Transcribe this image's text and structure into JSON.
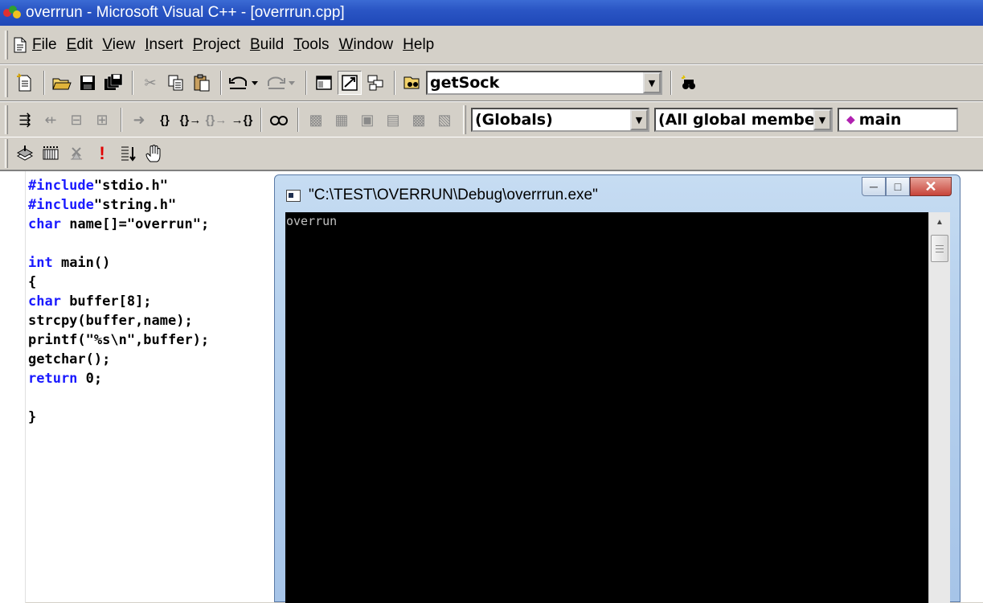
{
  "window": {
    "title": "overrrun - Microsoft Visual C++ - [overrrun.cpp]"
  },
  "menu": {
    "items": [
      {
        "u": "F",
        "rest": "ile"
      },
      {
        "u": "E",
        "rest": "dit"
      },
      {
        "u": "V",
        "rest": "iew"
      },
      {
        "u": "I",
        "rest": "nsert"
      },
      {
        "u": "P",
        "rest": "roject"
      },
      {
        "u": "B",
        "rest": "uild"
      },
      {
        "u": "T",
        "rest": "ools"
      },
      {
        "u": "W",
        "rest": "indow"
      },
      {
        "u": "H",
        "rest": "elp"
      }
    ]
  },
  "toolbar": {
    "find_value": "getSock",
    "class_combo": "(Globals)",
    "members_combo": "(All global members",
    "function_combo": "main"
  },
  "editor": {
    "lines": [
      [
        {
          "t": "#include",
          "kw": true
        },
        {
          "t": "\"stdio.h\"",
          "kw": false
        }
      ],
      [
        {
          "t": "#include",
          "kw": true
        },
        {
          "t": "\"string.h\"",
          "kw": false
        }
      ],
      [
        {
          "t": "char",
          "kw": true
        },
        {
          "t": " name[]=\"overrun\";",
          "kw": false
        }
      ],
      [],
      [
        {
          "t": "int",
          "kw": true
        },
        {
          "t": " main()",
          "kw": false
        }
      ],
      [
        {
          "t": "{",
          "kw": false
        }
      ],
      [
        {
          "t": "char",
          "kw": true
        },
        {
          "t": " buffer[8];",
          "kw": false
        }
      ],
      [
        {
          "t": "strcpy(buffer,name);",
          "kw": false
        }
      ],
      [
        {
          "t": "printf(\"%s\\n\",buffer);",
          "kw": false
        }
      ],
      [
        {
          "t": "getchar();",
          "kw": false
        }
      ],
      [
        {
          "t": "return",
          "kw": true
        },
        {
          "t": " 0;",
          "kw": false
        }
      ],
      [],
      [
        {
          "t": "}",
          "kw": false
        }
      ]
    ]
  },
  "console": {
    "title": "\"C:\\TEST\\OVERRUN\\Debug\\overrrun.exe\"",
    "output": "overrun"
  }
}
